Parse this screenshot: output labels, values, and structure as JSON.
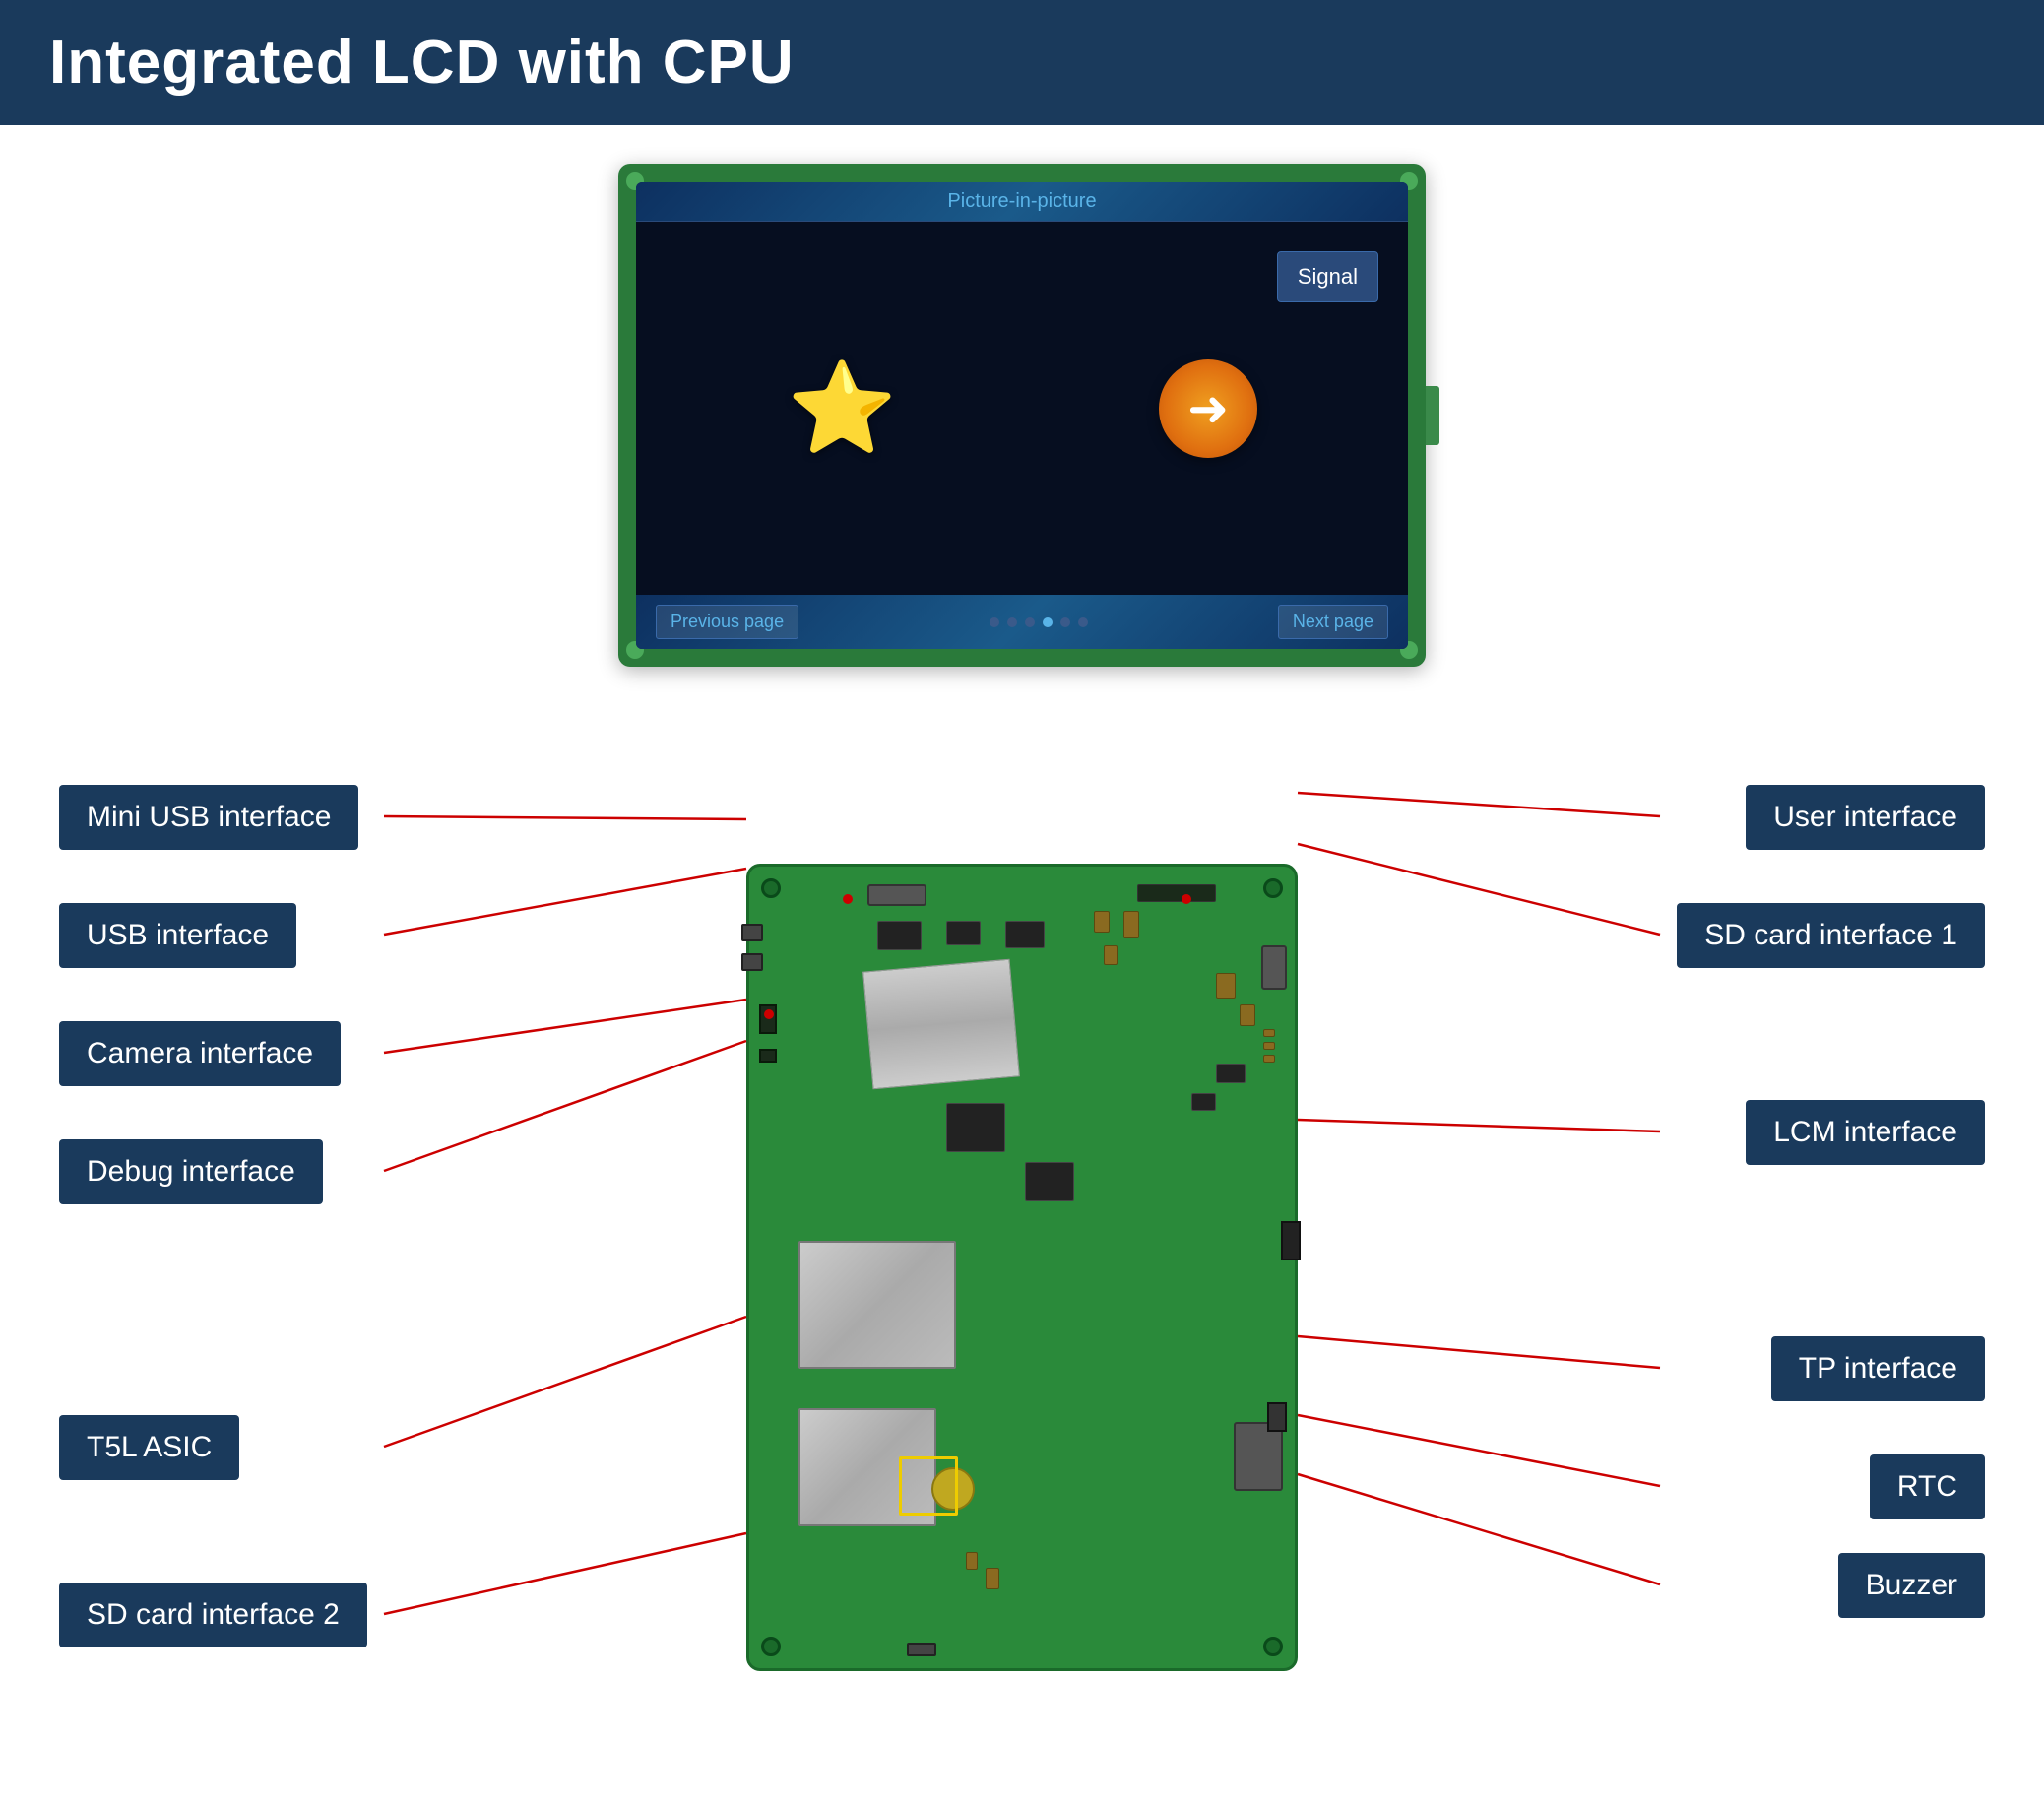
{
  "header": {
    "title": "Integrated LCD with CPU"
  },
  "lcd": {
    "top_label": "Picture-in-picture",
    "nav_prev": "Previous page",
    "nav_next": "Next page",
    "signal_label": "Signal"
  },
  "labels": {
    "mini_usb": "Mini USB interface",
    "usb": "USB interface",
    "camera": "Camera interface",
    "debug": "Debug interface",
    "t5l_asic": "T5L ASIC",
    "sd_card_2": "SD card interface 2",
    "user": "User interface",
    "sd_card_1": "SD card interface 1",
    "lcm": "LCM interface",
    "tp": "TP interface",
    "rtc": "RTC",
    "buzzer": "Buzzer"
  }
}
